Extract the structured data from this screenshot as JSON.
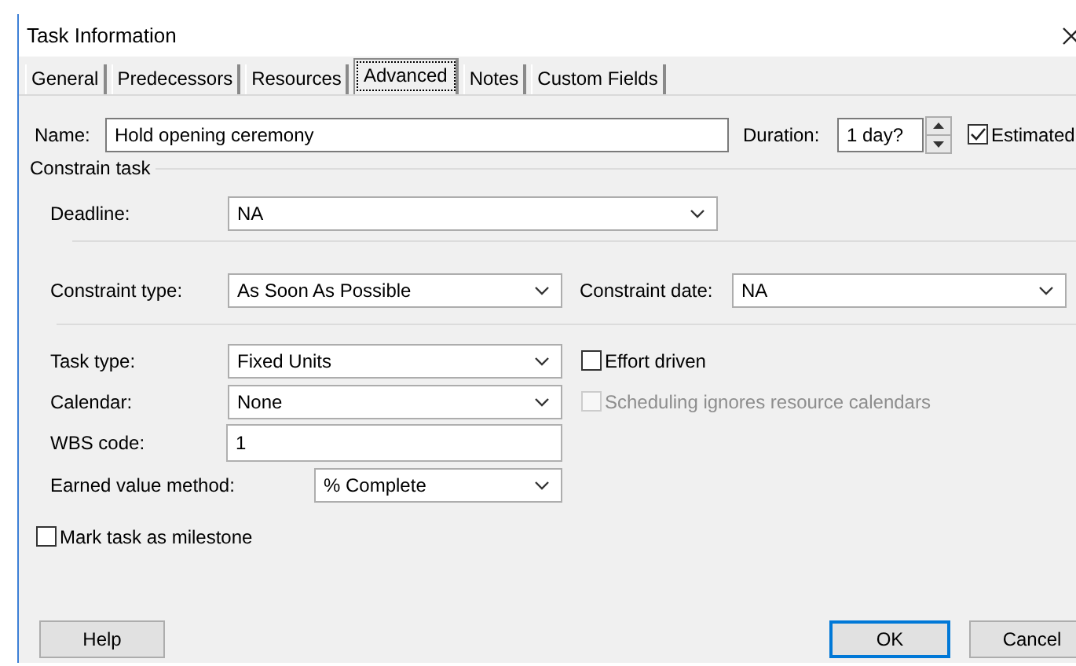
{
  "window": {
    "title": "Task Information"
  },
  "tabs": [
    {
      "label": "General",
      "selected": false
    },
    {
      "label": "Predecessors",
      "selected": false
    },
    {
      "label": "Resources",
      "selected": false
    },
    {
      "label": "Advanced",
      "selected": true
    },
    {
      "label": "Notes",
      "selected": false
    },
    {
      "label": "Custom Fields",
      "selected": false
    }
  ],
  "name": {
    "label": "Name:",
    "value": "Hold opening ceremony"
  },
  "duration": {
    "label": "Duration:",
    "value": "1 day?"
  },
  "estimated": {
    "label": "Estimated",
    "checked": true
  },
  "constrain_task": {
    "title": "Constrain task",
    "deadline": {
      "label": "Deadline:",
      "value": "NA"
    },
    "constraint_type": {
      "label": "Constraint type:",
      "value": "As Soon As Possible"
    },
    "constraint_date": {
      "label": "Constraint date:",
      "value": "NA"
    }
  },
  "task_type": {
    "label": "Task type:",
    "value": "Fixed Units"
  },
  "effort_driven": {
    "label": "Effort driven",
    "checked": false,
    "disabled": false
  },
  "calendar": {
    "label": "Calendar:",
    "value": "None"
  },
  "scheduling_ignores": {
    "label": "Scheduling ignores resource calendars",
    "checked": false,
    "disabled": true
  },
  "wbs_code": {
    "label": "WBS code:",
    "value": "1"
  },
  "earned_value_method": {
    "label": "Earned value method:",
    "value": "% Complete"
  },
  "milestone": {
    "label": "Mark task as milestone",
    "checked": false,
    "disabled": false
  },
  "buttons": [
    {
      "label": "Help",
      "default": false
    },
    {
      "label": "OK",
      "default": true
    },
    {
      "label": "Cancel",
      "default": false
    }
  ]
}
